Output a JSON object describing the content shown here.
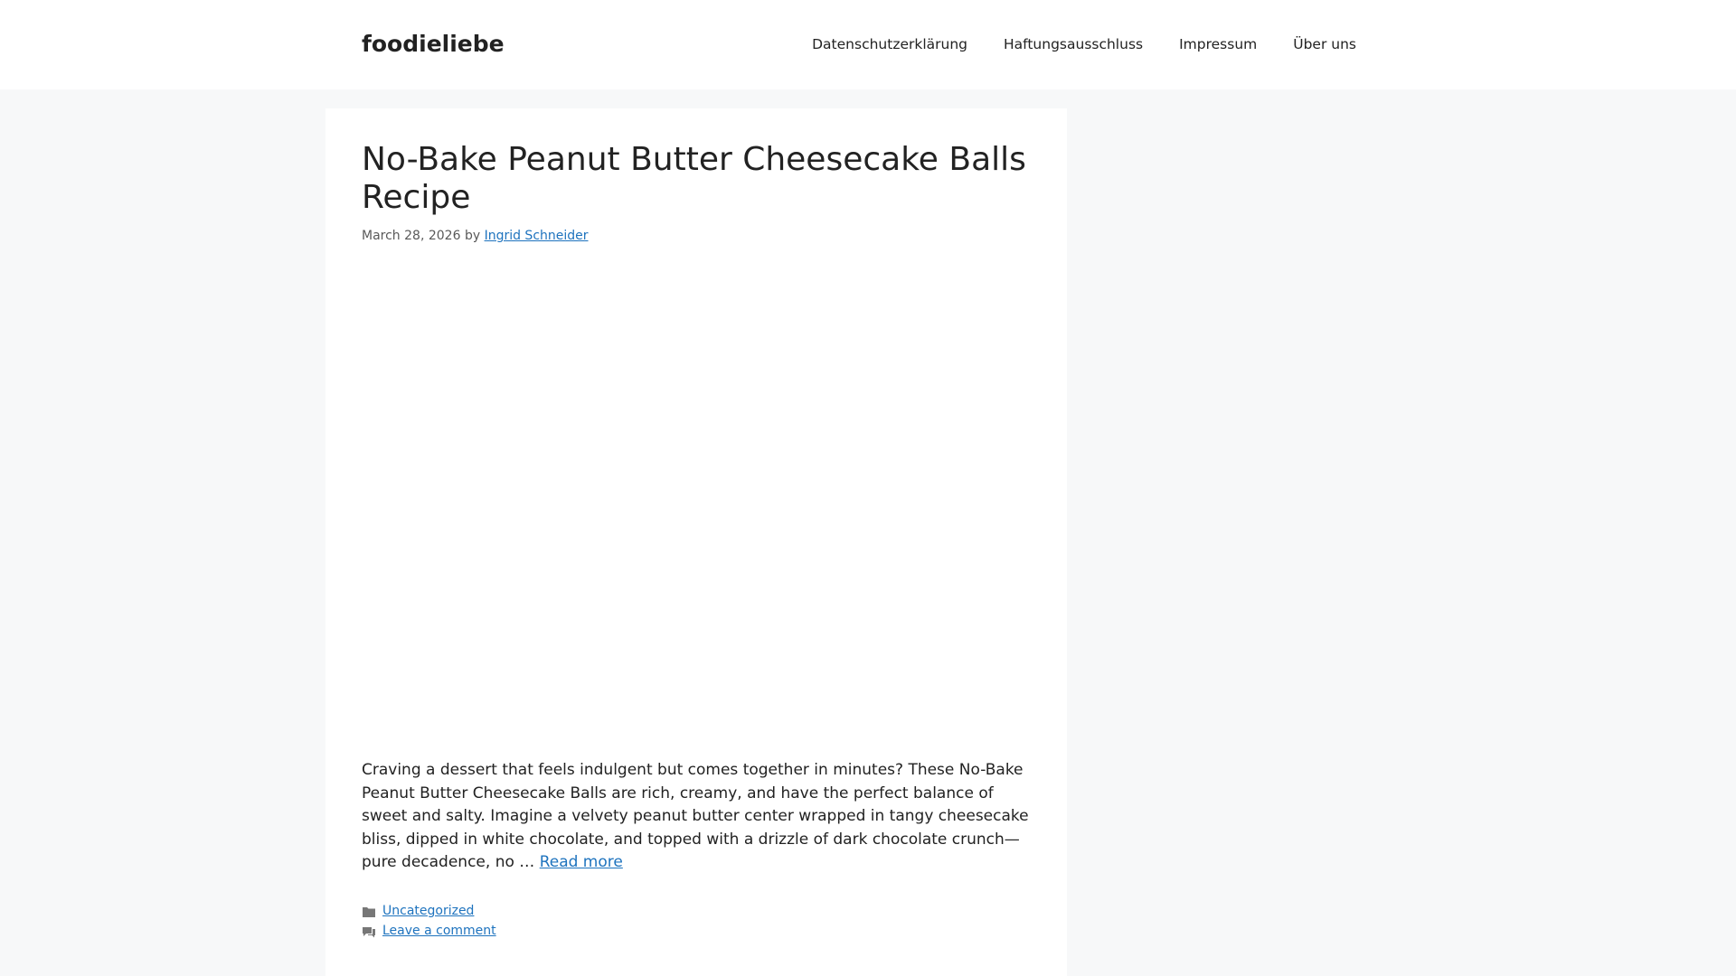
{
  "header": {
    "site_title": "foodieliebe",
    "nav": [
      {
        "label": "Datenschutzerklärung"
      },
      {
        "label": "Haftungsausschluss"
      },
      {
        "label": "Impressum"
      },
      {
        "label": "Über uns"
      }
    ]
  },
  "post": {
    "title": "No-Bake Peanut Butter Cheesecake Balls Recipe",
    "date": "March 28, 2026",
    "by": "by",
    "author": "Ingrid Schneider",
    "excerpt": "Craving a dessert that feels indulgent but comes together in minutes? These No-Bake Peanut Butter Cheesecake Balls are rich, creamy, and have the perfect balance of sweet and salty. Imagine a velvety peanut butter center wrapped in tangy cheesecake bliss, dipped in white chocolate, and topped with a drizzle of dark chocolate crunch—pure decadence, no …",
    "read_more": "Read more",
    "category": "Uncategorized",
    "comment_link": "Leave a comment"
  },
  "icons": {
    "category": "folder-icon",
    "comment": "comment-icon"
  },
  "colors": {
    "link": "#1e73be",
    "background": "#f7f8f9"
  }
}
